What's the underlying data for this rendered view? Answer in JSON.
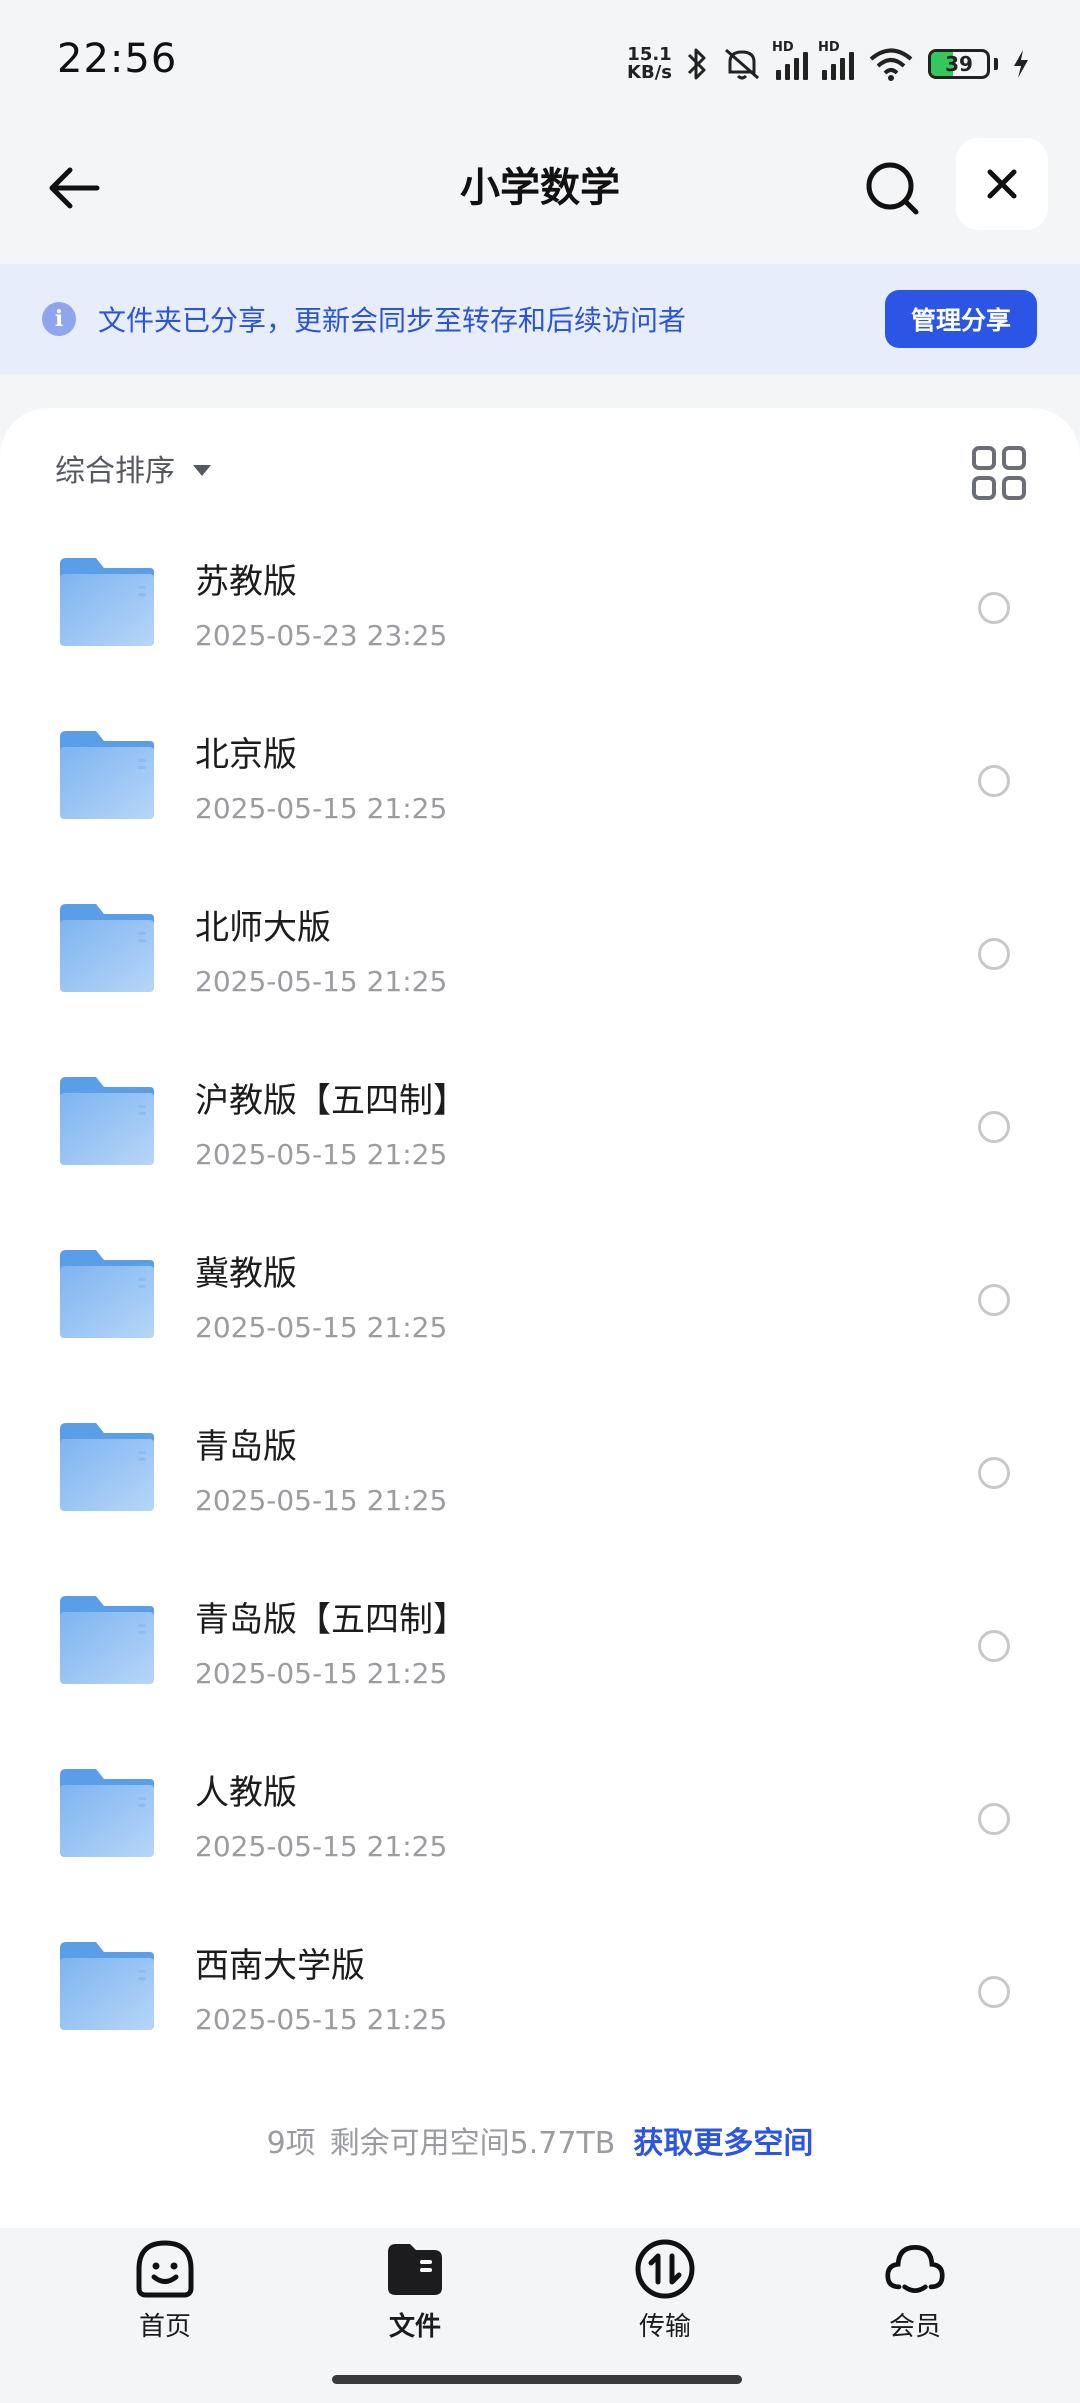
{
  "status_bar": {
    "time": "22:56",
    "net_speed_value": "15.1",
    "net_speed_unit": "KB/s",
    "battery_level": "39",
    "icons": [
      "bluetooth-icon",
      "mute-icon",
      "signal-icon",
      "signal-icon",
      "wifi-icon",
      "battery-icon",
      "charging-icon"
    ]
  },
  "header": {
    "title": "小学数学",
    "back_icon": "arrow-left-icon",
    "search_icon": "search-icon",
    "close_icon": "close-icon"
  },
  "share_banner": {
    "text": "文件夹已分享，更新会同步至转存和后续访问者",
    "button_label": "管理分享",
    "accent_color": "#2a55e5"
  },
  "toolbar": {
    "sort_label": "综合排序",
    "view_toggle_icon": "grid-view-icon"
  },
  "files": [
    {
      "name": "苏教版",
      "date": "2025-05-23 23:25"
    },
    {
      "name": "北京版",
      "date": "2025-05-15 21:25"
    },
    {
      "name": "北师大版",
      "date": "2025-05-15 21:25"
    },
    {
      "name": "沪教版【五四制】",
      "date": "2025-05-15 21:25"
    },
    {
      "name": "冀教版",
      "date": "2025-05-15 21:25"
    },
    {
      "name": "青岛版",
      "date": "2025-05-15 21:25"
    },
    {
      "name": "青岛版【五四制】",
      "date": "2025-05-15 21:25"
    },
    {
      "name": "人教版",
      "date": "2025-05-15 21:25"
    },
    {
      "name": "西南大学版",
      "date": "2025-05-15 21:25"
    }
  ],
  "footer": {
    "count": "9项",
    "space": "剩余可用空间5.77TB",
    "get_more": "获取更多空间"
  },
  "bottom_nav": {
    "items": [
      {
        "label": "首页",
        "icon": "home-smiley-icon"
      },
      {
        "label": "文件",
        "icon": "files-folder-icon",
        "active": true
      },
      {
        "label": "传输",
        "icon": "transfer-icon"
      },
      {
        "label": "会员",
        "icon": "member-cloud-icon"
      }
    ]
  }
}
